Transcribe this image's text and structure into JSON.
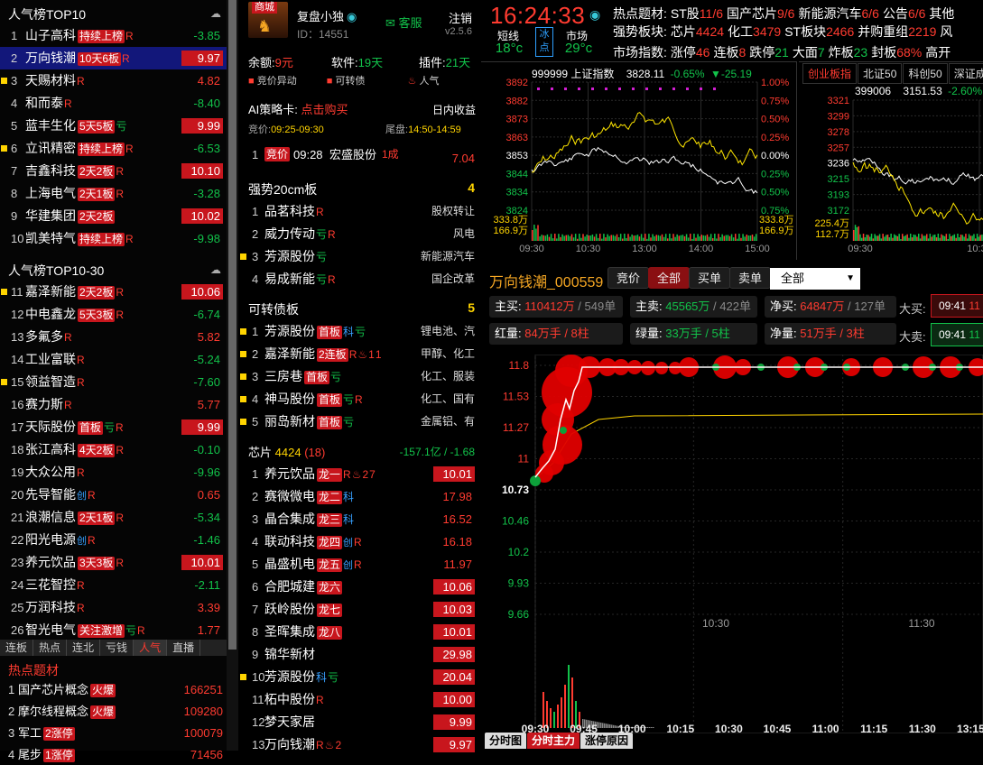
{
  "left": {
    "top10_title": "人气榜TOP10",
    "top10": [
      {
        "rank": "1",
        "name": "山子高科",
        "tag": "持续上榜",
        "r": "R",
        "value": "-3.85",
        "up": false,
        "sq": false
      },
      {
        "rank": "2",
        "name": "万向钱潮",
        "tag": "10天6板",
        "r": "R",
        "value": "9.97",
        "up": true,
        "sq": false,
        "sel": true
      },
      {
        "rank": "3",
        "name": "天赐材料",
        "tag": "",
        "r": "R",
        "value": "4.82",
        "up": false,
        "pos": true,
        "sq": true
      },
      {
        "rank": "4",
        "name": "和而泰",
        "tag": "",
        "r": "R",
        "value": "-8.40",
        "up": false,
        "sq": false
      },
      {
        "rank": "5",
        "name": "蓝丰生化",
        "tag": "5天5板",
        "r": "亏",
        "value": "9.99",
        "up": true,
        "sq": false
      },
      {
        "rank": "6",
        "name": "立讯精密",
        "tag": "持续上榜",
        "r": "R",
        "value": "-6.53",
        "up": false,
        "sq": true
      },
      {
        "rank": "7",
        "name": "吉鑫科技",
        "tag": "2天2板",
        "r": "R",
        "value": "10.10",
        "up": true,
        "sq": false
      },
      {
        "rank": "8",
        "name": "上海电气",
        "tag": "2天1板",
        "r": "R",
        "value": "-3.28",
        "up": false,
        "sq": false
      },
      {
        "rank": "9",
        "name": "华建集团",
        "tag": "2天2板",
        "r": "",
        "value": "10.02",
        "up": true,
        "sq": false
      },
      {
        "rank": "10",
        "name": "凯美特气",
        "tag": "持续上榜",
        "r": "R",
        "value": "-9.98",
        "up": false,
        "sq": false
      }
    ],
    "top30_title": "人气榜TOP10-30",
    "top30": [
      {
        "rank": "11",
        "name": "嘉泽新能",
        "tag": "2天2板",
        "r": "R",
        "value": "10.06",
        "up": true,
        "sq": true
      },
      {
        "rank": "12",
        "name": "中电鑫龙",
        "tag": "5天3板",
        "r": "R",
        "value": "-6.74",
        "up": false,
        "sq": false
      },
      {
        "rank": "13",
        "name": "多氟多",
        "tag": "",
        "r": "R",
        "value": "5.82",
        "up": false,
        "pos": true,
        "sq": false
      },
      {
        "rank": "14",
        "name": "工业富联",
        "tag": "",
        "r": "R",
        "value": "-5.24",
        "up": false,
        "sq": false
      },
      {
        "rank": "15",
        "name": "领益智造",
        "tag": "",
        "r": "R",
        "value": "-7.60",
        "up": false,
        "sq": true
      },
      {
        "rank": "16",
        "name": "赛力斯",
        "tag": "",
        "r": "R",
        "value": "5.77",
        "up": false,
        "pos": true,
        "sq": false
      },
      {
        "rank": "17",
        "name": "天际股份",
        "tag": "首板",
        "r": "亏R",
        "value": "9.99",
        "up": true,
        "sq": false
      },
      {
        "rank": "18",
        "name": "张江高科",
        "tag": "4天2板",
        "r": "R",
        "value": "-0.10",
        "up": false,
        "sq": false
      },
      {
        "rank": "19",
        "name": "大众公用",
        "tag": "",
        "r": "R",
        "value": "-9.96",
        "up": false,
        "sq": false
      },
      {
        "rank": "20",
        "name": "先导智能",
        "tag": "",
        "r": "创R",
        "value": "0.65",
        "up": false,
        "pos": true,
        "sq": false
      },
      {
        "rank": "21",
        "name": "浪潮信息",
        "tag": "2天1板",
        "r": "R",
        "value": "-5.34",
        "up": false,
        "sq": false
      },
      {
        "rank": "22",
        "name": "阳光电源",
        "tag": "",
        "r": "创R",
        "value": "-1.46",
        "up": false,
        "sq": false
      },
      {
        "rank": "23",
        "name": "养元饮品",
        "tag": "3天3板",
        "r": "R",
        "value": "10.01",
        "up": true,
        "sq": false
      },
      {
        "rank": "24",
        "name": "三花智控",
        "tag": "",
        "r": "R",
        "value": "-2.11",
        "up": false,
        "sq": false
      },
      {
        "rank": "25",
        "name": "万润科技",
        "tag": "",
        "r": "R",
        "value": "3.39",
        "up": false,
        "pos": true,
        "sq": false
      },
      {
        "rank": "26",
        "name": "智光电气",
        "tag": "关注激增",
        "r": "亏R",
        "value": "1.77",
        "up": false,
        "pos": true,
        "sq": false
      }
    ],
    "tabs": [
      "连板",
      "热点",
      "连北",
      "亏钱",
      "人气",
      "直播"
    ],
    "active_tab": "人气",
    "hot_title": "热点题材",
    "hot": [
      {
        "rank": "1",
        "name": "国产芯片概念",
        "tag": "火爆",
        "value": "166251"
      },
      {
        "rank": "2",
        "name": "摩尔线程概念",
        "tag": "火爆",
        "value": "109280"
      },
      {
        "rank": "3",
        "name": "军工",
        "tag": "2涨停",
        "value": "100079"
      },
      {
        "rank": "4",
        "name": "尾步",
        "tag": "1涨停",
        "value": "71456"
      }
    ]
  },
  "mid": {
    "app_name": "复盘小独",
    "app_id": "ID：14551",
    "badge": "商城",
    "service": "客服",
    "logout": "注销",
    "version": "v2.5.6",
    "balance_label": "余额:",
    "balance_value": "9元",
    "software_label": "软件:",
    "software_value": "19天",
    "plugin_label": "插件:",
    "plugin_value": "21天",
    "checks": [
      "竞价异动",
      "可转债",
      "人气"
    ],
    "ai_label": "AI策略卡:",
    "ai_buy": "点击购买",
    "ai_right": "日内收益",
    "auction_label": "竞价:",
    "auction_time": "09:25-09:30",
    "tail_label": "尾盘:",
    "tail_time": "14:50-14:59",
    "first_row": {
      "rank": "1",
      "tag": "竞价",
      "time": "09:28",
      "name": "宏盛股份",
      "sub": "1成",
      "value": "7.04"
    },
    "s20_title": "强势20cm板",
    "s20_count": "4",
    "s20": [
      {
        "rank": "1",
        "name": "品茗科技",
        "r": "R",
        "right": "股权转让",
        "sq": false
      },
      {
        "rank": "2",
        "name": "威力传动",
        "r": "亏R",
        "right": "风电",
        "sq": false
      },
      {
        "rank": "3",
        "name": "芳源股份",
        "r": "亏",
        "right": "新能源汽车",
        "sq": true
      },
      {
        "rank": "4",
        "name": "易成新能",
        "r": "亏R",
        "right": "国企改革",
        "sq": false
      }
    ],
    "cb_title": "可转债板",
    "cb_count": "5",
    "cb": [
      {
        "rank": "1",
        "name": "芳源股份",
        "tag": "首板",
        "r": "科亏",
        "right": "锂电池、汽",
        "sq": true
      },
      {
        "rank": "2",
        "name": "嘉泽新能",
        "tag": "2连板",
        "r": "R♨11",
        "right": "甲醇、化工",
        "sq": true
      },
      {
        "rank": "3",
        "name": "三房巷",
        "tag": "首板",
        "r": "亏",
        "right": "化工、服装",
        "sq": true
      },
      {
        "rank": "4",
        "name": "神马股份",
        "tag": "首板",
        "r": "亏R",
        "right": "化工、国有",
        "sq": true
      },
      {
        "rank": "5",
        "name": "丽岛新材",
        "tag": "首板",
        "r": "亏",
        "right": "金属铝、有",
        "sq": true
      }
    ],
    "chip_title": "芯片",
    "chip_num": "4424",
    "chip_count": "(18)",
    "chip_flow": "-157.1亿 / -1.68",
    "chip": [
      {
        "rank": "1",
        "name": "养元饮品",
        "tag": "龙一",
        "r": "R♨27",
        "value": "10.01",
        "up": true,
        "sq": false
      },
      {
        "rank": "2",
        "name": "赛微微电",
        "tag": "龙二",
        "r": "科",
        "value": "17.98",
        "up": false,
        "sq": false
      },
      {
        "rank": "3",
        "name": "晶合集成",
        "tag": "龙三",
        "r": "科",
        "value": "16.52",
        "up": false,
        "sq": false
      },
      {
        "rank": "4",
        "name": "联动科技",
        "tag": "龙四",
        "r": "创R",
        "value": "16.18",
        "up": false,
        "sq": false
      },
      {
        "rank": "5",
        "name": "晶盛机电",
        "tag": "龙五",
        "r": "创R",
        "value": "11.97",
        "up": false,
        "sq": false
      },
      {
        "rank": "6",
        "name": "合肥城建",
        "tag": "龙六",
        "r": "",
        "value": "10.06",
        "up": true,
        "sq": false
      },
      {
        "rank": "7",
        "name": "跃岭股份",
        "tag": "龙七",
        "r": "",
        "value": "10.03",
        "up": true,
        "sq": false
      },
      {
        "rank": "8",
        "name": "圣晖集成",
        "tag": "龙八",
        "r": "",
        "value": "10.01",
        "up": true,
        "sq": false
      },
      {
        "rank": "9",
        "name": "锦华新材",
        "tag": "",
        "r": "",
        "value": "29.98",
        "up": true,
        "sq": false
      },
      {
        "rank": "10",
        "name": "芳源股份",
        "tag": "",
        "r": "科亏",
        "value": "20.04",
        "up": true,
        "sq": true
      },
      {
        "rank": "11",
        "name": "柘中股份",
        "tag": "",
        "r": "R",
        "value": "10.00",
        "up": true,
        "sq": false
      },
      {
        "rank": "12",
        "name": "梦天家居",
        "tag": "",
        "r": "",
        "value": "9.99",
        "up": true,
        "sq": false
      },
      {
        "rank": "13",
        "name": "万向钱潮",
        "tag": "",
        "r": "R♨2",
        "value": "9.97",
        "up": true,
        "sq": false
      }
    ]
  },
  "right": {
    "clock": "16:24:33",
    "short_label": "短线",
    "short_temp": "18°c",
    "ice_top": "冰",
    "ice_bot": "点",
    "market_label": "市场",
    "market_temp": "29°c",
    "hot_topic_label": "热点题材:",
    "hot_topics": [
      {
        "name": "ST股",
        "count": "11/6"
      },
      {
        "name": "国产芯片",
        "count": "9/6"
      },
      {
        "name": "新能源汽车",
        "count": "6/6"
      },
      {
        "name": "公告",
        "count": "6/6"
      },
      {
        "name": "其他",
        "count": ""
      }
    ],
    "strong_label": "强势板块:",
    "strong": [
      {
        "name": "芯片",
        "count": "4424"
      },
      {
        "name": "化工",
        "count": "3479"
      },
      {
        "name": "ST板块",
        "count": "2466"
      },
      {
        "name": "并购重组",
        "count": "2219"
      },
      {
        "name": "风",
        "count": ""
      }
    ],
    "market_idx_label": "市场指数:",
    "market_idx": [
      {
        "name": "涨停",
        "count": "46"
      },
      {
        "name": "连板",
        "count": "8"
      },
      {
        "name": "跌停",
        "count": "21"
      },
      {
        "name": "大面",
        "count": "7"
      },
      {
        "name": "炸板",
        "count": "23"
      },
      {
        "name": "封板",
        "count": "68%"
      },
      {
        "name": "高开",
        "count": ""
      }
    ],
    "idx1": {
      "code": "999999 上证指数",
      "price": "3828.11",
      "pct": "-0.65%",
      "chg": "▼-25.19",
      "left_ticks": [
        "3892",
        "3882",
        "3873",
        "3863",
        "3853",
        "3844",
        "3834",
        "3824"
      ],
      "right_ticks": [
        "1.00%",
        "0.75%",
        "0.50%",
        "0.25%",
        "0.00%",
        "0.25%",
        "0.50%",
        "0.75%"
      ],
      "vol_top": "333.8万",
      "vol_bot": "166.9万",
      "times": [
        "09:30",
        "10:30",
        "13:00",
        "14:00",
        "15:00"
      ]
    },
    "idx2_tabs": [
      "创业板指",
      "北证50",
      "科创50",
      "深证成指"
    ],
    "idx2": {
      "code": "399006",
      "price": "3151.53",
      "pct": "-2.60%",
      "left_ticks": [
        "3321",
        "3299",
        "3278",
        "3257",
        "3236",
        "3215",
        "3193",
        "3172"
      ],
      "vol_top": "225.4万",
      "vol_bot": "112.7万",
      "times": [
        "09:30",
        "10:30"
      ]
    },
    "stock_title": "万向钱潮_000559",
    "buttons": [
      "竞价",
      "全部",
      "买单",
      "卖单"
    ],
    "active_button": "全部",
    "select_value": "全部",
    "flow": {
      "main_buy_label": "主买:",
      "main_buy": "110412万",
      "main_buy_n": "549单",
      "main_sell_label": "主卖:",
      "main_sell": "45565万",
      "main_sell_n": "422单",
      "net_buy_label": "净买:",
      "net_buy": "64847万",
      "net_buy_n": "127单",
      "big_buy_label": "大买:",
      "big_buy_time": "09:41",
      "big_buy_v": "11",
      "red_label": "红量:",
      "red_v": "84万手 / 8柱",
      "green_label": "绿量:",
      "green_v": "33万手 / 5柱",
      "net_label": "净量:",
      "net_v": "51万手 / 3柱",
      "big_sell_label": "大卖:",
      "big_sell_time": "09:41",
      "big_sell_v": "11"
    },
    "price_ticks": [
      "11.8",
      "11.53",
      "11.27",
      "11",
      "10.73",
      "10.46",
      "10.2",
      "9.93",
      "9.66"
    ],
    "mid_times": [
      "10:30",
      "11:30"
    ],
    "bottom_times": [
      "09:30",
      "09:45",
      "10:00",
      "10:15",
      "10:30",
      "10:45",
      "11:00",
      "11:15",
      "11:30",
      "13:15"
    ],
    "bottom_tabs": [
      "分时图",
      "分时主力",
      "涨停原因"
    ],
    "active_bottom_tab": "分时主力"
  },
  "colors": {
    "up": "#ff3b30",
    "down": "#12c24a",
    "accent": "#c8161d",
    "select": "#12177a"
  }
}
